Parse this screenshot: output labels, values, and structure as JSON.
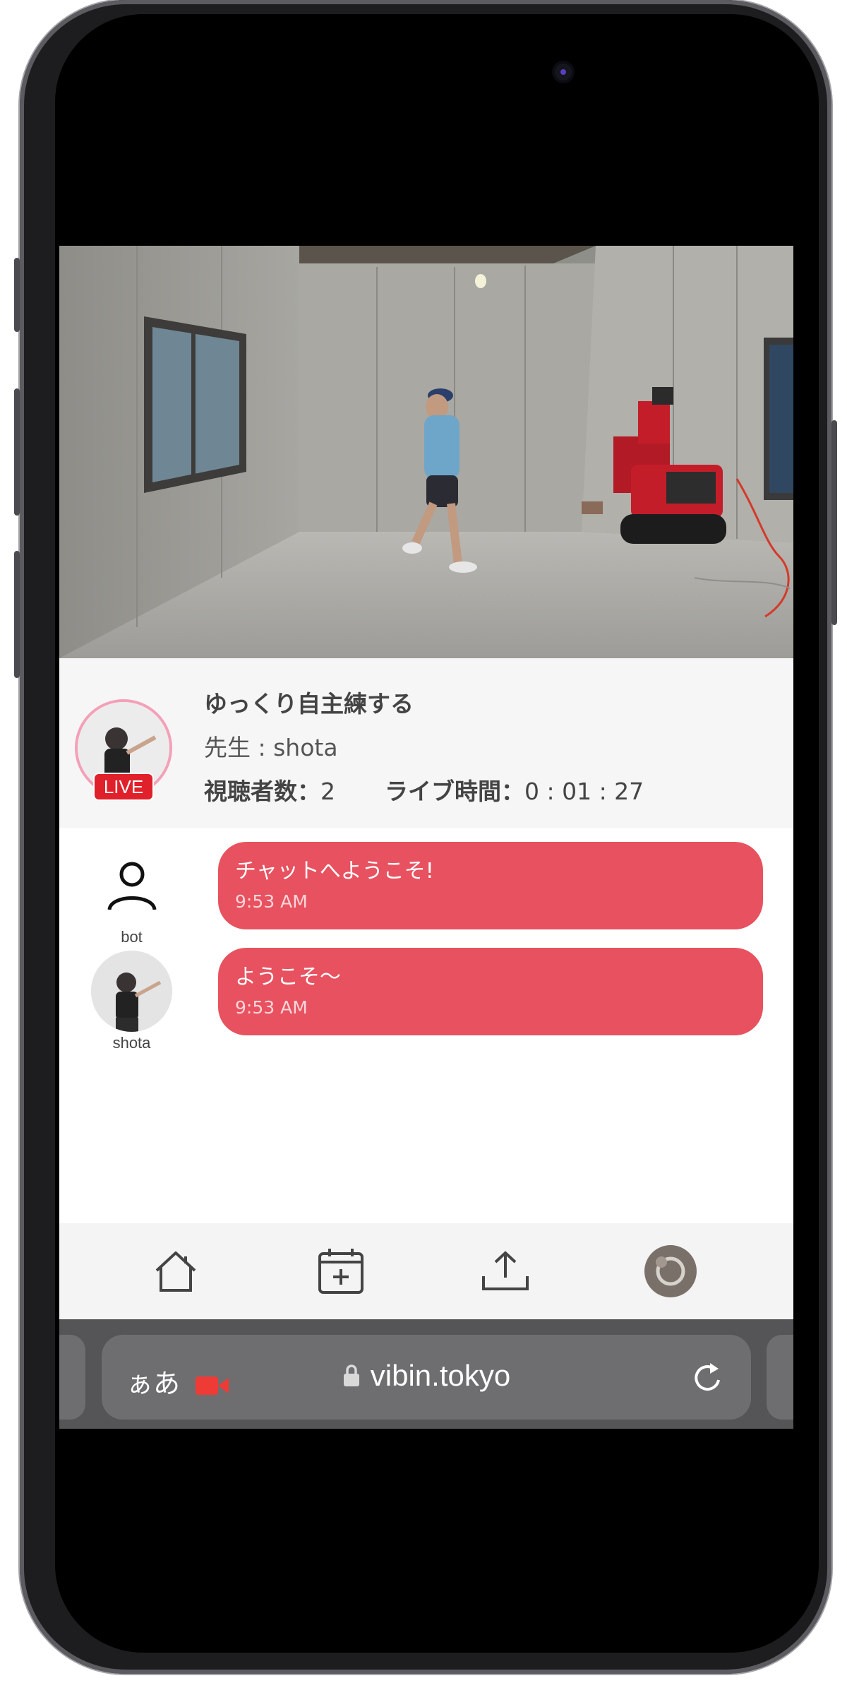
{
  "stream": {
    "title": "ゆっくり自主練する",
    "teacher": "先生 : shota",
    "live_badge": "LIVE",
    "viewers_label": "視聴者数：",
    "viewers_value": "2",
    "live_time_label": "ライブ時間：",
    "live_time_value": "0 : 01 : 27"
  },
  "chat": {
    "messages": [
      {
        "user": "bot",
        "text": "チャットへようこそ!",
        "time": "9:53 AM"
      },
      {
        "user": "shota",
        "text": "ようこそ〜",
        "time": "9:53 AM"
      }
    ]
  },
  "nav": {
    "items": [
      {
        "icon": "home-icon"
      },
      {
        "icon": "calendar-add-icon"
      },
      {
        "icon": "share-icon"
      },
      {
        "icon": "profile-avatar"
      }
    ]
  },
  "browser": {
    "aa_label": "ぁあ",
    "url": "vibin.tokyo",
    "icons": [
      "record-icon",
      "lock-icon",
      "reload-icon"
    ]
  },
  "colors": {
    "accent": "#e8515f",
    "live": "#e0202a",
    "ring": "#f3a0b8"
  }
}
